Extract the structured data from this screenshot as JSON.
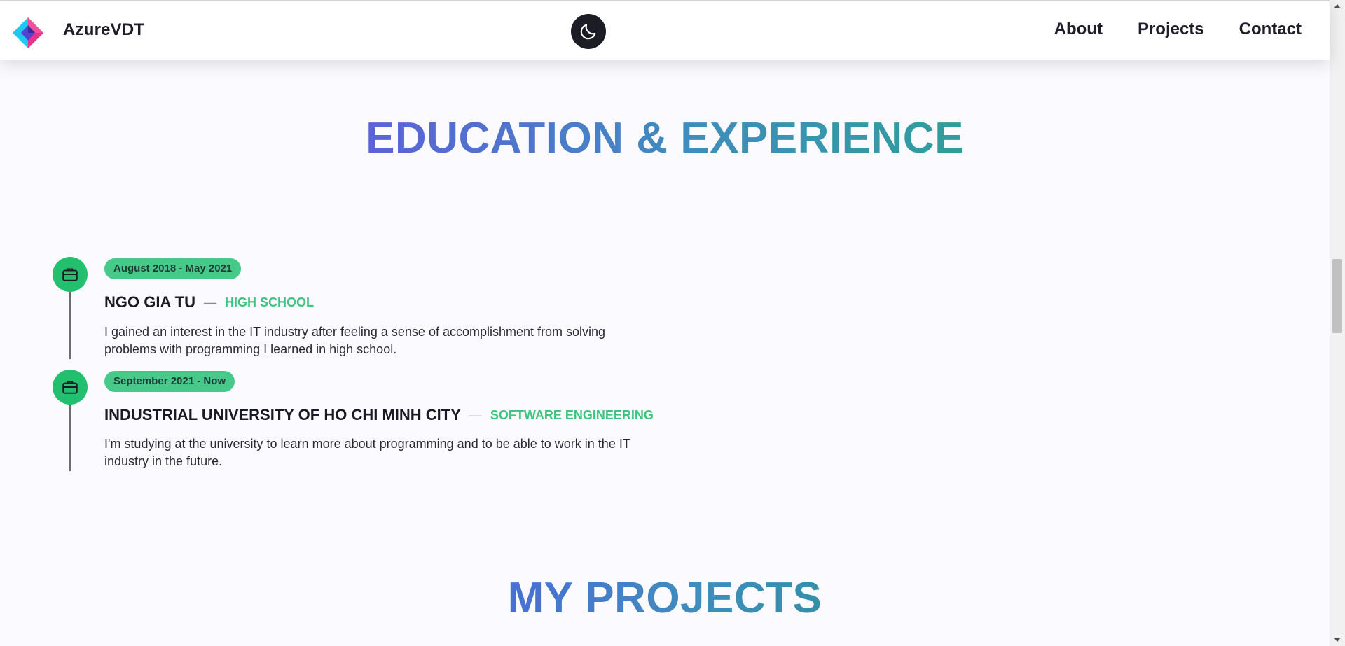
{
  "header": {
    "brand": "AzureVDT",
    "nav": [
      "About",
      "Projects",
      "Contact"
    ]
  },
  "sections": {
    "education_title": "EDUCATION & EXPERIENCE",
    "projects_title": "MY PROJECTS"
  },
  "timeline": [
    {
      "date": "August 2018 - May 2021",
      "organization": "NGO GIA TU",
      "field": "HIGH SCHOOL",
      "description": "I gained an interest in the IT industry after feeling a sense of accomplishment from solving problems with programming I learned in high school."
    },
    {
      "date": "September 2021 - Now",
      "organization": "INDUSTRIAL UNIVERSITY OF HO CHI MINH CITY",
      "field": "SOFTWARE ENGINEERING",
      "description": "I'm studying at the university to learn more about programming and to be able to work in the IT industry in the future."
    }
  ],
  "icons": {
    "logo": "diamond-logo-icon",
    "theme_toggle": "moon-icon",
    "timeline": "briefcase-icon"
  },
  "colors": {
    "accent_green": "#22c06e",
    "badge_green": "#47c98a",
    "field_green": "#3dc47e",
    "title_gradient_start": "#5b62d8",
    "title_gradient_end": "#2e9e9b"
  }
}
